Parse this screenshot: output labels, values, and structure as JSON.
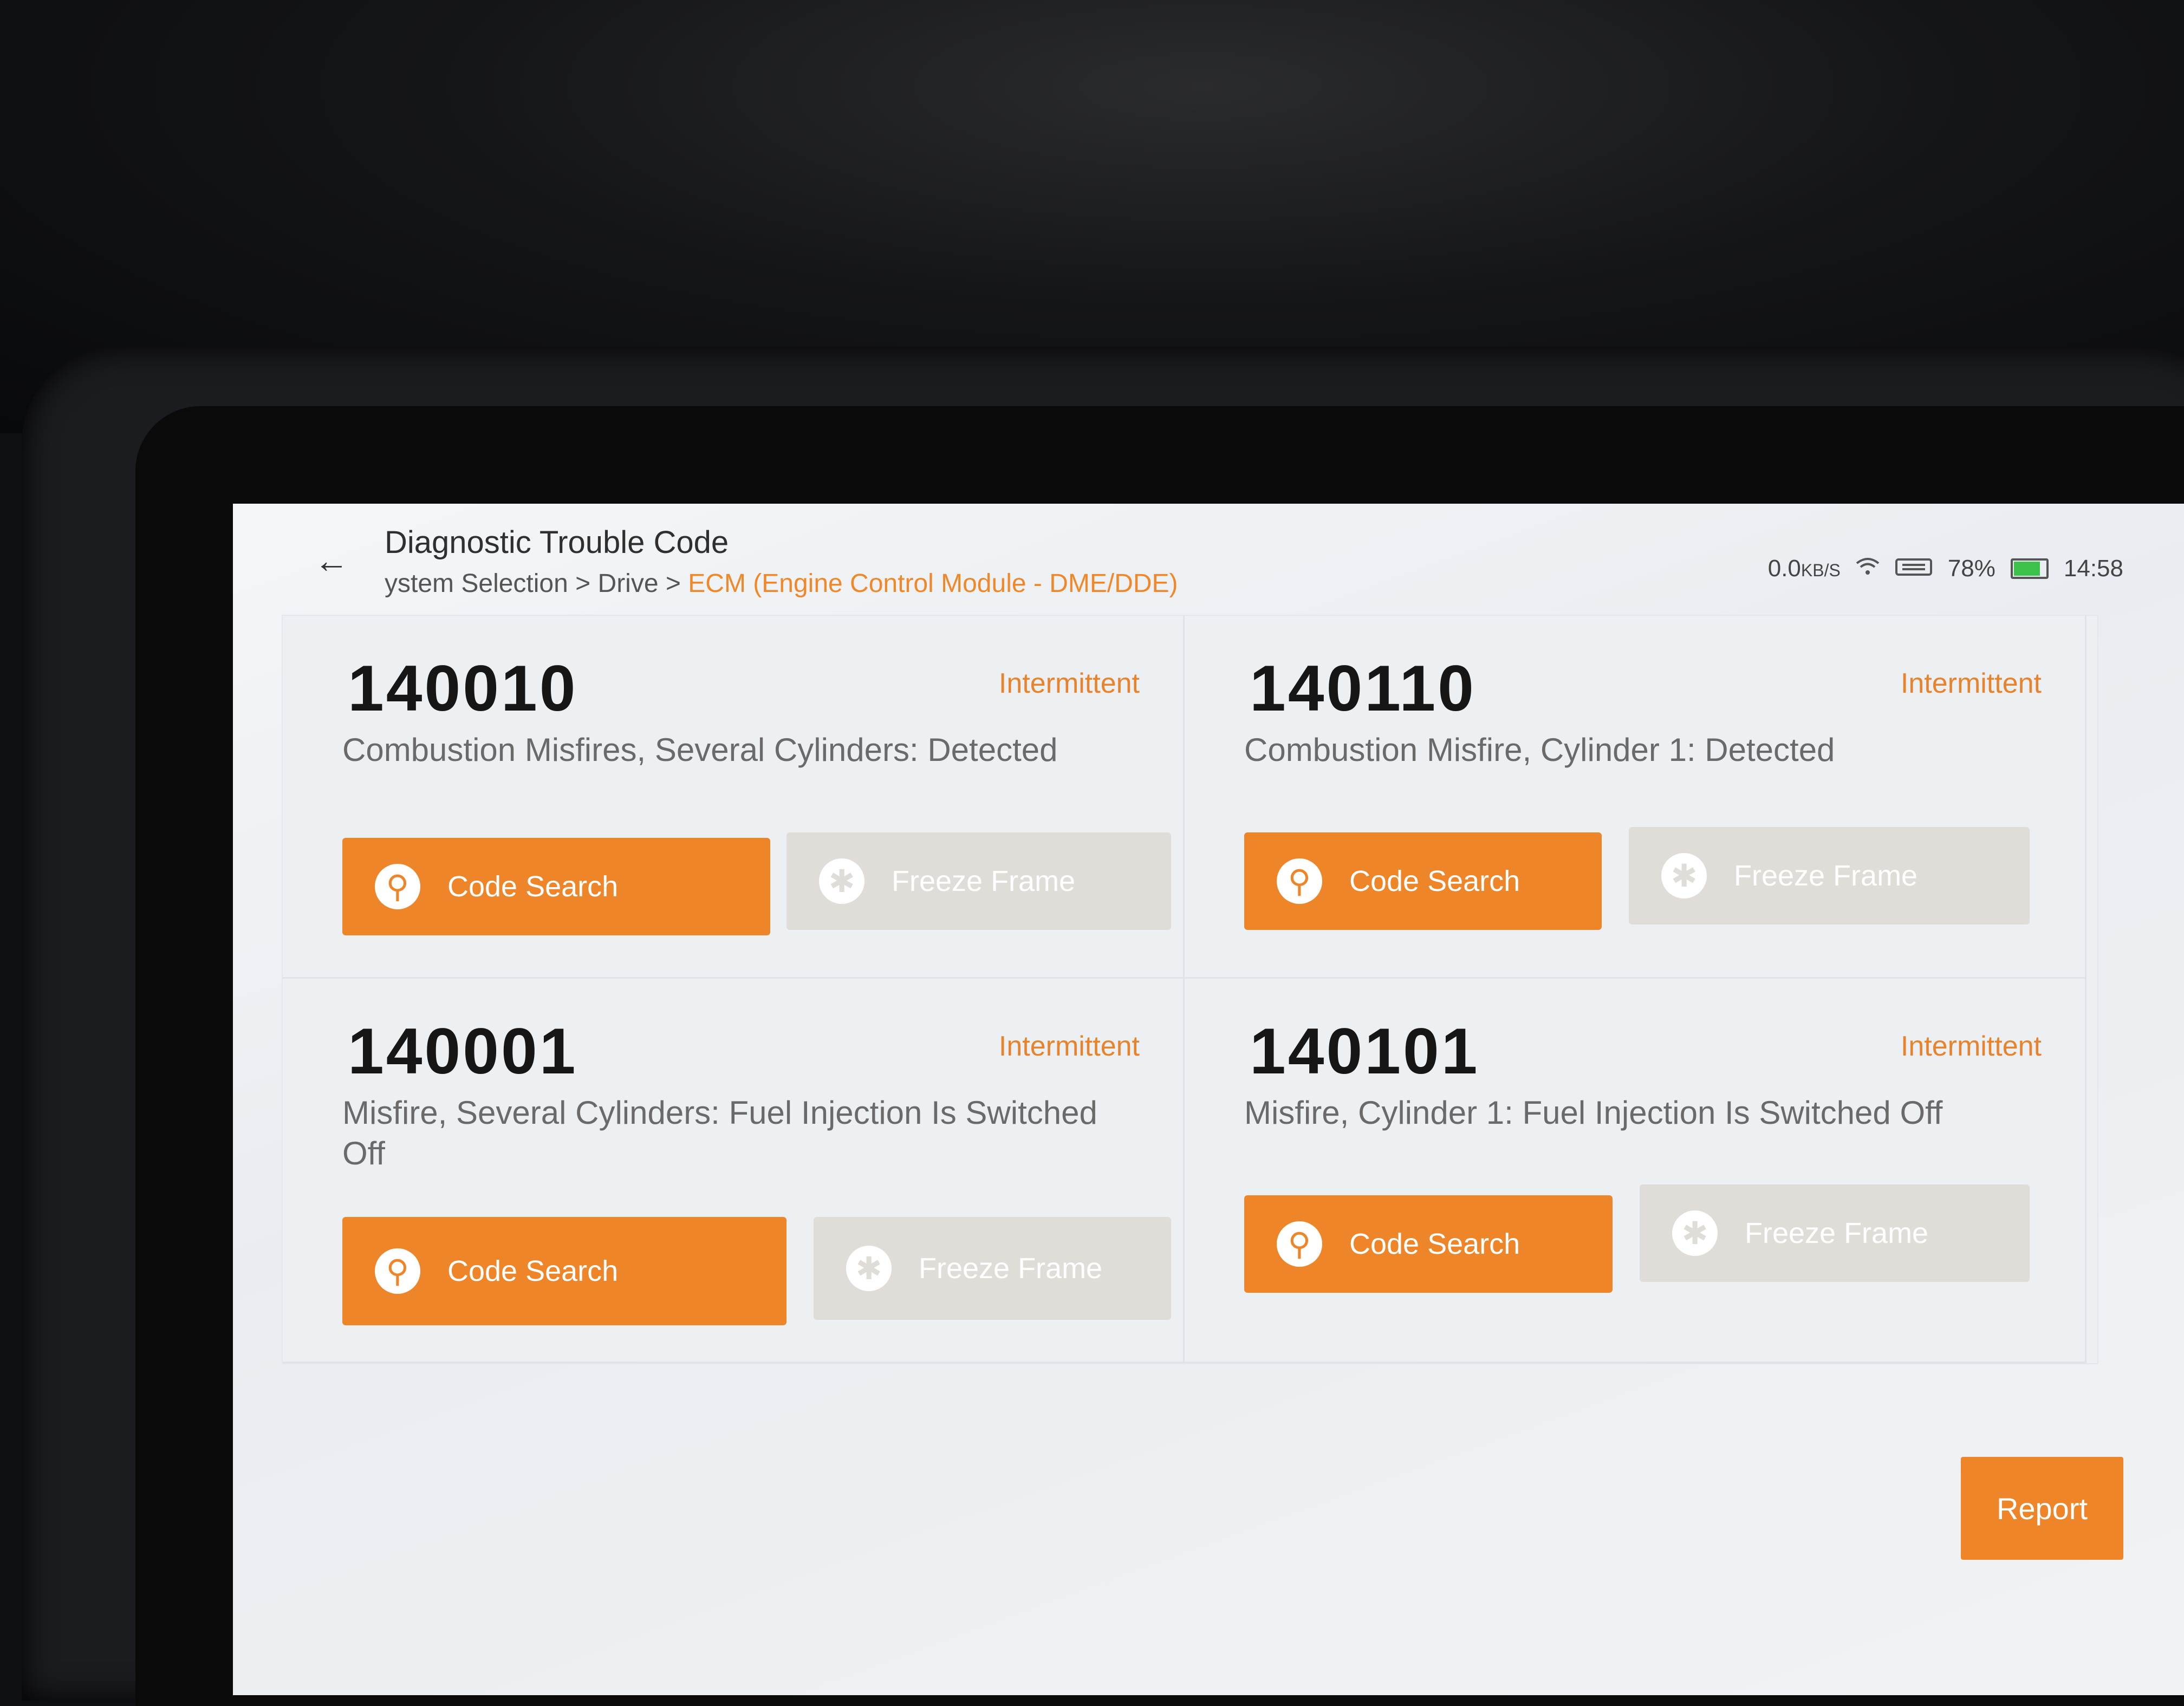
{
  "header": {
    "title": "Diagnostic Trouble Code",
    "breadcrumb": {
      "items": [
        "ystem Selection",
        "Drive"
      ],
      "separator": ">",
      "active": "ECM (Engine Control Module - DME/DDE)"
    }
  },
  "status_bar": {
    "data_rate": "0.0",
    "data_rate_unit": "KB/S",
    "battery_percent": "78%",
    "battery_level": 0.78,
    "time": "14:58"
  },
  "codes": [
    {
      "code": "140010",
      "status": "Intermittent",
      "description": "Combustion Misfires, Several Cylinders: Detected",
      "search_label": "Code Search",
      "freeze_label": "Freeze Frame"
    },
    {
      "code": "140110",
      "status": "Intermittent",
      "description": "Combustion Misfire, Cylinder 1: Detected",
      "search_label": "Code Search",
      "freeze_label": "Freeze Frame"
    },
    {
      "code": "140001",
      "status": "Intermittent",
      "description": "Misfire, Several Cylinders: Fuel Injection Is Switched Off",
      "search_label": "Code Search",
      "freeze_label": "Freeze Frame"
    },
    {
      "code": "140101",
      "status": "Intermittent",
      "description": "Misfire, Cylinder 1: Fuel Injection Is Switched Off",
      "search_label": "Code Search",
      "freeze_label": "Freeze Frame"
    }
  ],
  "footer": {
    "report_label": "Report"
  },
  "colors": {
    "accent": "#ee8529",
    "disabled_button": "#e0dcd8",
    "battery": "#3cc14a"
  },
  "icons": {
    "back": "arrow-left-icon",
    "search": "search-icon",
    "freeze": "asterisk-icon",
    "wifi": "wifi-icon",
    "vci": "vci-icon",
    "battery": "battery-icon"
  }
}
